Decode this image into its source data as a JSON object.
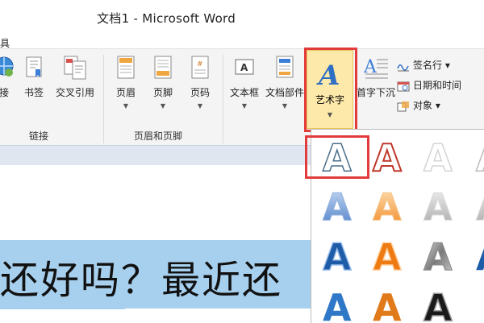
{
  "window": {
    "title": "文档1 - Microsoft Word"
  },
  "menu": {
    "tab_label": "具"
  },
  "ribbon": {
    "buttons": [
      {
        "id": "hyperlink",
        "label": "接"
      },
      {
        "id": "bookmark",
        "label": "书签"
      },
      {
        "id": "cross_reference",
        "label": "交叉引用"
      },
      {
        "id": "header",
        "label": "页眉"
      },
      {
        "id": "footer",
        "label": "页脚"
      },
      {
        "id": "page_number",
        "label": "页码"
      },
      {
        "id": "text_box",
        "label": "文本框"
      },
      {
        "id": "quick_parts",
        "label": "文档部件"
      },
      {
        "id": "wordart",
        "label": "艺术字"
      },
      {
        "id": "drop_cap",
        "label": "首字下沉"
      }
    ],
    "small_buttons": [
      {
        "id": "signature_line",
        "label": "签名行 ▾"
      },
      {
        "id": "date_time",
        "label": "日期和时间"
      },
      {
        "id": "object",
        "label": "对象 ▾"
      }
    ],
    "groups": [
      {
        "label": "链接"
      },
      {
        "label": "页眉和页脚"
      }
    ]
  },
  "document": {
    "visible_text": "还好吗？最近还"
  },
  "wordart_gallery": {
    "styles": [
      "plain-outline",
      "red-outline",
      "light-gray-outline",
      "blue-gradient",
      "orange-gradient",
      "silver-gradient",
      "blue-fill-shadow",
      "orange-fill-shadow",
      "gray-metallic",
      "blue-bold",
      "orange-bold",
      "black-bold"
    ],
    "selected_index": 0
  },
  "colors": {
    "accent_highlight": "#e23b3b",
    "selection_blue": "#a7d0ee",
    "active_button": "#fde9a9"
  }
}
